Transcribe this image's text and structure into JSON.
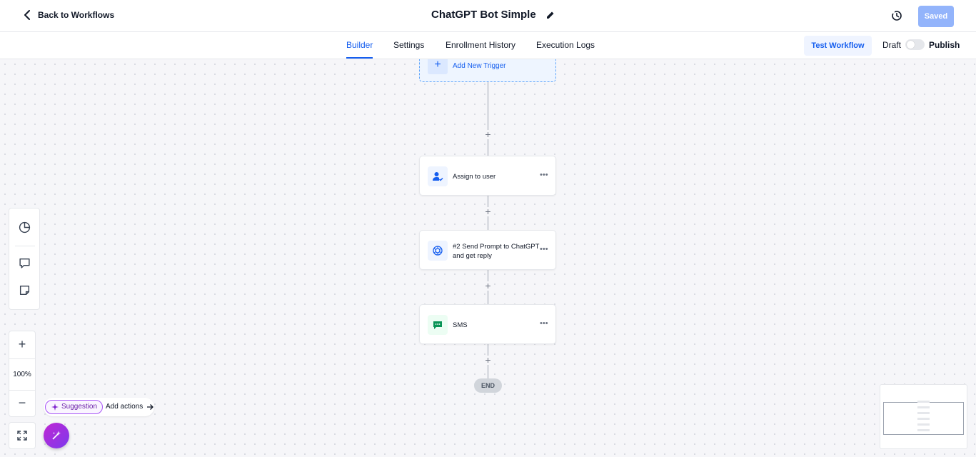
{
  "header": {
    "back_label": "Back to Workflows",
    "title": "ChatGPT Bot Simple",
    "saved_label": "Saved"
  },
  "tabs": {
    "items": [
      {
        "label": "Builder",
        "active": true
      },
      {
        "label": "Settings",
        "active": false
      },
      {
        "label": "Enrollment History",
        "active": false
      },
      {
        "label": "Execution Logs",
        "active": false
      }
    ],
    "test_label": "Test Workflow",
    "draft_label": "Draft",
    "publish_label": "Publish",
    "publish_enabled": false
  },
  "workflow": {
    "trigger_label": "Add New Trigger",
    "nodes": [
      {
        "label": "Assign to user",
        "icon": "user-assign-icon"
      },
      {
        "label": "#2 Send Prompt to ChatGPT and get reply",
        "icon": "chatgpt-icon"
      },
      {
        "label": "SMS",
        "icon": "sms-icon"
      }
    ],
    "end_label": "END"
  },
  "zoom": {
    "level": "100%"
  },
  "suggestion": {
    "badge": "Suggestion",
    "action": "Add actions"
  },
  "colors": {
    "accent": "#155eef",
    "saved_button": "#93b4fb",
    "sms_green": "#079455"
  }
}
